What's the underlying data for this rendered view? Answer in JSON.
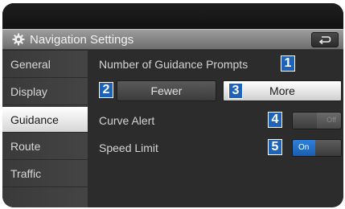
{
  "header": {
    "title": "Navigation Settings",
    "settings_icon": "gear-icon",
    "back_icon": "back-arrow-icon"
  },
  "sidebar": {
    "items": [
      {
        "label": "General",
        "active": false
      },
      {
        "label": "Display",
        "active": false
      },
      {
        "label": "Guidance",
        "active": true
      },
      {
        "label": "Route",
        "active": false
      },
      {
        "label": "Traffic",
        "active": false
      }
    ]
  },
  "guidance": {
    "prompts_label": "Number of Guidance Prompts",
    "fewer_label": "Fewer",
    "more_label": "More",
    "selected_prompts": "More",
    "curve_alert_label": "Curve Alert",
    "curve_alert_state": "Off",
    "speed_limit_label": "Speed Limit",
    "speed_limit_state": "On"
  },
  "callouts": [
    "1",
    "2",
    "3",
    "4",
    "5"
  ],
  "colors": {
    "callout_blue": "#1e63b8",
    "toggle_on_blue": "#2f7fd9",
    "background": "#2c2c2c"
  }
}
